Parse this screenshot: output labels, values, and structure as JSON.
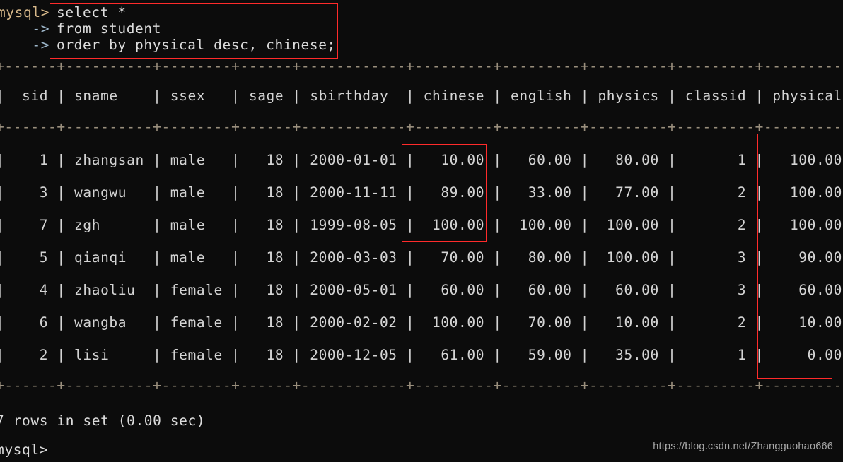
{
  "terminal": {
    "background_color": "#0c0c0c",
    "text_color": "#d4d4d4",
    "highlight_color": "#ff2b2b",
    "prompt": "mysql>",
    "continuation_prompt": "    ->",
    "trailing_prompt": "mysql>"
  },
  "query": {
    "lines": [
      "select *",
      "from student",
      "order by physical desc, chinese;"
    ],
    "prompts": [
      "mysql>",
      "    ->",
      "    ->"
    ]
  },
  "result_table": {
    "columns": [
      "sid",
      "sname",
      "ssex",
      "sage",
      "sbirthday",
      "chinese",
      "english",
      "physics",
      "classid",
      "physical"
    ],
    "rule": "+------+----------+--------+------+------------+---------+---------+---------+---------+----------+",
    "header_row": "|  sid | sname    | ssex   | sage | sbirthday  | chinese | english | physics | classid | physical |",
    "rows": [
      {
        "cells": [
          "1",
          "zhangsan",
          "male",
          "18",
          "2000-01-01",
          "10.00",
          "60.00",
          "80.00",
          "1",
          "100.00"
        ],
        "text": "|    1 | zhangsan | male   |   18 | 2000-01-01 |   10.00 |   60.00 |   80.00 |       1 |   100.00 |"
      },
      {
        "cells": [
          "3",
          "wangwu",
          "male",
          "18",
          "2000-11-11",
          "89.00",
          "33.00",
          "77.00",
          "2",
          "100.00"
        ],
        "text": "|    3 | wangwu   | male   |   18 | 2000-11-11 |   89.00 |   33.00 |   77.00 |       2 |   100.00 |"
      },
      {
        "cells": [
          "7",
          "zgh",
          "male",
          "18",
          "1999-08-05",
          "100.00",
          "100.00",
          "100.00",
          "2",
          "100.00"
        ],
        "text": "|    7 | zgh      | male   |   18 | 1999-08-05 |  100.00 |  100.00 |  100.00 |       2 |   100.00 |"
      },
      {
        "cells": [
          "5",
          "qianqi",
          "male",
          "18",
          "2000-03-03",
          "70.00",
          "80.00",
          "100.00",
          "3",
          "90.00"
        ],
        "text": "|    5 | qianqi   | male   |   18 | 2000-03-03 |   70.00 |   80.00 |  100.00 |       3 |    90.00 |"
      },
      {
        "cells": [
          "4",
          "zhaoliu",
          "female",
          "18",
          "2000-05-01",
          "60.00",
          "60.00",
          "60.00",
          "3",
          "60.00"
        ],
        "text": "|    4 | zhaoliu  | female |   18 | 2000-05-01 |   60.00 |   60.00 |   60.00 |       3 |    60.00 |"
      },
      {
        "cells": [
          "6",
          "wangba",
          "female",
          "18",
          "2000-02-02",
          "100.00",
          "70.00",
          "10.00",
          "2",
          "10.00"
        ],
        "text": "|    6 | wangba   | female |   18 | 2000-02-02 |  100.00 |   70.00 |   10.00 |       2 |    10.00 |"
      },
      {
        "cells": [
          "2",
          "lisi",
          "female",
          "18",
          "2000-12-05",
          "61.00",
          "59.00",
          "35.00",
          "1",
          "0.00"
        ],
        "text": "|    2 | lisi     | female |   18 | 2000-12-05 |   61.00 |   59.00 |   35.00 |       1 |     0.00 |"
      }
    ]
  },
  "status": {
    "rows_message": "7 rows in set (0.00 sec)"
  },
  "annotations": {
    "query_box_label": "highlighted-query",
    "chinese_box_label": "highlighted-chinese-values",
    "physical_box_label": "highlighted-physical-values"
  },
  "watermark": {
    "url": "https://blog.csdn.net/Zhangguohao666"
  }
}
